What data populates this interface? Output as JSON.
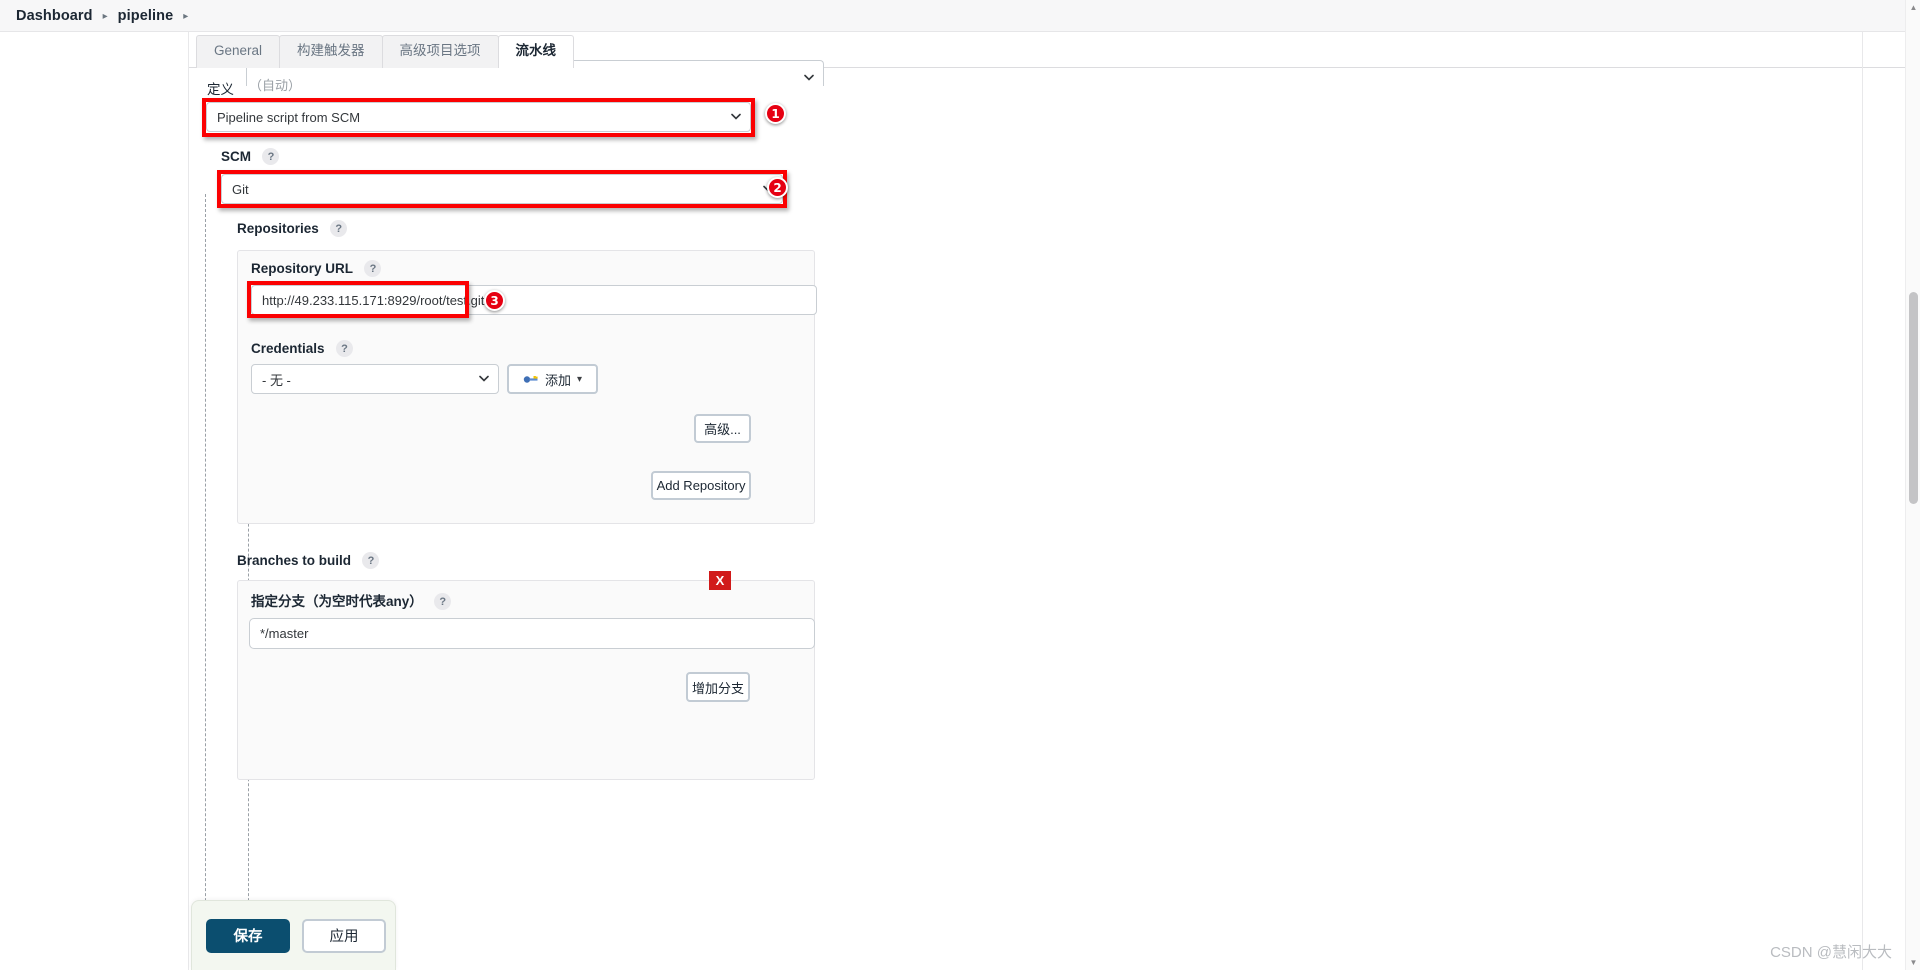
{
  "breadcrumb": {
    "items": [
      "Dashboard",
      "pipeline"
    ],
    "separator": "▸"
  },
  "tabs": [
    {
      "label": "General",
      "active": false
    },
    {
      "label": "构建触发器",
      "active": false
    },
    {
      "label": "高级项目选项",
      "active": false
    },
    {
      "label": "流水线",
      "active": true
    }
  ],
  "definition": {
    "label": "定义",
    "selected": "Pipeline script from SCM",
    "badge": "1"
  },
  "scm": {
    "label": "SCM",
    "help": "?",
    "selected": "Git",
    "badge": "2"
  },
  "repositories": {
    "label": "Repositories",
    "help": "?",
    "repository_url": {
      "label": "Repository URL",
      "help": "?",
      "value": "http://49.233.115.171:8929/root/test.git",
      "badge": "3"
    },
    "credentials": {
      "label": "Credentials",
      "help": "?",
      "selected": "- 无 -",
      "add_button": "添加",
      "add_caret": "▾"
    },
    "advanced_button": "高级...",
    "add_repository_button": "Add Repository"
  },
  "branches": {
    "label": "Branches to build",
    "help": "?",
    "remove_marker": "X",
    "branch_specifier": {
      "label": "指定分支（为空时代表any）",
      "help": "?",
      "value": "*/master"
    },
    "add_branch_button": "增加分支"
  },
  "footer": {
    "save_button": "保存",
    "apply_button": "应用",
    "hidden_label": "（自动）"
  },
  "watermark": "CSDN @慧闲大大",
  "colors": {
    "annotation_red": "#fb0102",
    "badge_red": "#e60012",
    "save_navy": "#0b4e6f",
    "x_red": "#d11a1a"
  }
}
